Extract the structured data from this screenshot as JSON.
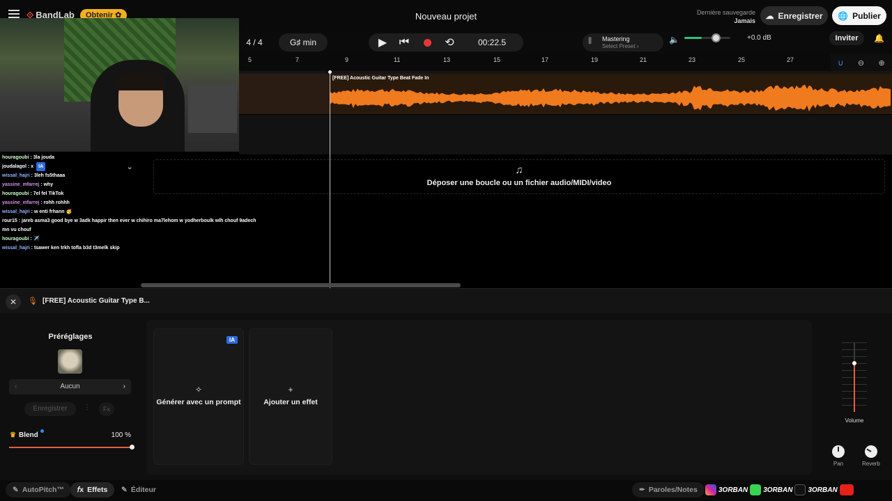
{
  "topbar": {
    "logo": "BandLab",
    "obtain_label": "Obtenir ✿",
    "project_title": "Nouveau projet",
    "last_save_label": "Dernière sauvegarde",
    "last_save_value": "Jamais",
    "save_label": "Enregistrer",
    "publish_label": "Publier"
  },
  "transport": {
    "time_signature": "4 / 4",
    "key": "G♯ min",
    "time": "00:22.5",
    "mastering_label": "Mastering",
    "mastering_preset": "Select Preset ›",
    "volume_db": "+0.0 dB",
    "master_volume_fraction": 0.68,
    "invite_label": "Inviter"
  },
  "ruler": {
    "marks": [
      "5",
      "7",
      "9",
      "11",
      "13",
      "15",
      "17",
      "19",
      "21",
      "23",
      "25",
      "27"
    ]
  },
  "track": {
    "clip_name": "[FREE] Acoustic Guitar Type Beat Fade In",
    "clip_color": "#f07a1e"
  },
  "drop_zone": {
    "text": "Déposer une boucle ou un fichier audio/MIDI/video"
  },
  "chat": {
    "messages": [
      {
        "user": "houragoubi",
        "text": "3la jouda",
        "color": "green"
      },
      {
        "user": "joudalagol",
        "text": "x",
        "color": "white"
      },
      {
        "user": "wissal_hajri",
        "text": "3leh fs5thaaa",
        "color": "blue"
      },
      {
        "user": "yassine_mfarrej",
        "text": "why",
        "color": "pink"
      },
      {
        "user": "houragoubi",
        "text": "7el fel TikTok",
        "color": "green"
      },
      {
        "user": "yassine_mfarrej",
        "text": "rohh rohhh",
        "color": "pink"
      },
      {
        "user": "wissal_hajri",
        "text": "w enti frhann 🥳",
        "color": "blue"
      },
      {
        "user": "rour15",
        "text": "jareb asma3 good bye w 3adk happir then ever w chihiro ma7lehom w yodherboulk wlh chouf 9adech mn vu chouf",
        "color": "white"
      },
      {
        "user": "houragoubi",
        "text": "✈️",
        "color": "green"
      },
      {
        "user": "wissal_hajri",
        "text": "tsawer ken trkh tofla b3d t3melk skip",
        "color": "blue"
      }
    ],
    "ia_label": "IA"
  },
  "panel": {
    "title": "[FREE] Acoustic Guitar Type B...",
    "presets_title": "Préréglages",
    "preset_value": "Aucun",
    "save_label": "Enregistrer",
    "fx_label": "Fx",
    "blend_label": "Blend",
    "blend_value": "100 %",
    "generate_label": "Générer avec un prompt",
    "ia_badge": "IA",
    "add_effect_label": "Ajouter un effet",
    "volume_label": "Volume",
    "volume_level": 0.7,
    "pan_label": "Pan",
    "reverb_label": "Reverb"
  },
  "footer": {
    "autopitch": "AutoPitch™",
    "effects": "Effets",
    "editor": "Éditeur",
    "lyrics": "Paroles/Notes",
    "social_handle": "3ORBAN"
  },
  "colors": {
    "accent_orange": "#f07a1e",
    "record_red": "#e53935",
    "ia_blue": "#2d6cdf",
    "obtain_yellow": "#f2b01e"
  }
}
